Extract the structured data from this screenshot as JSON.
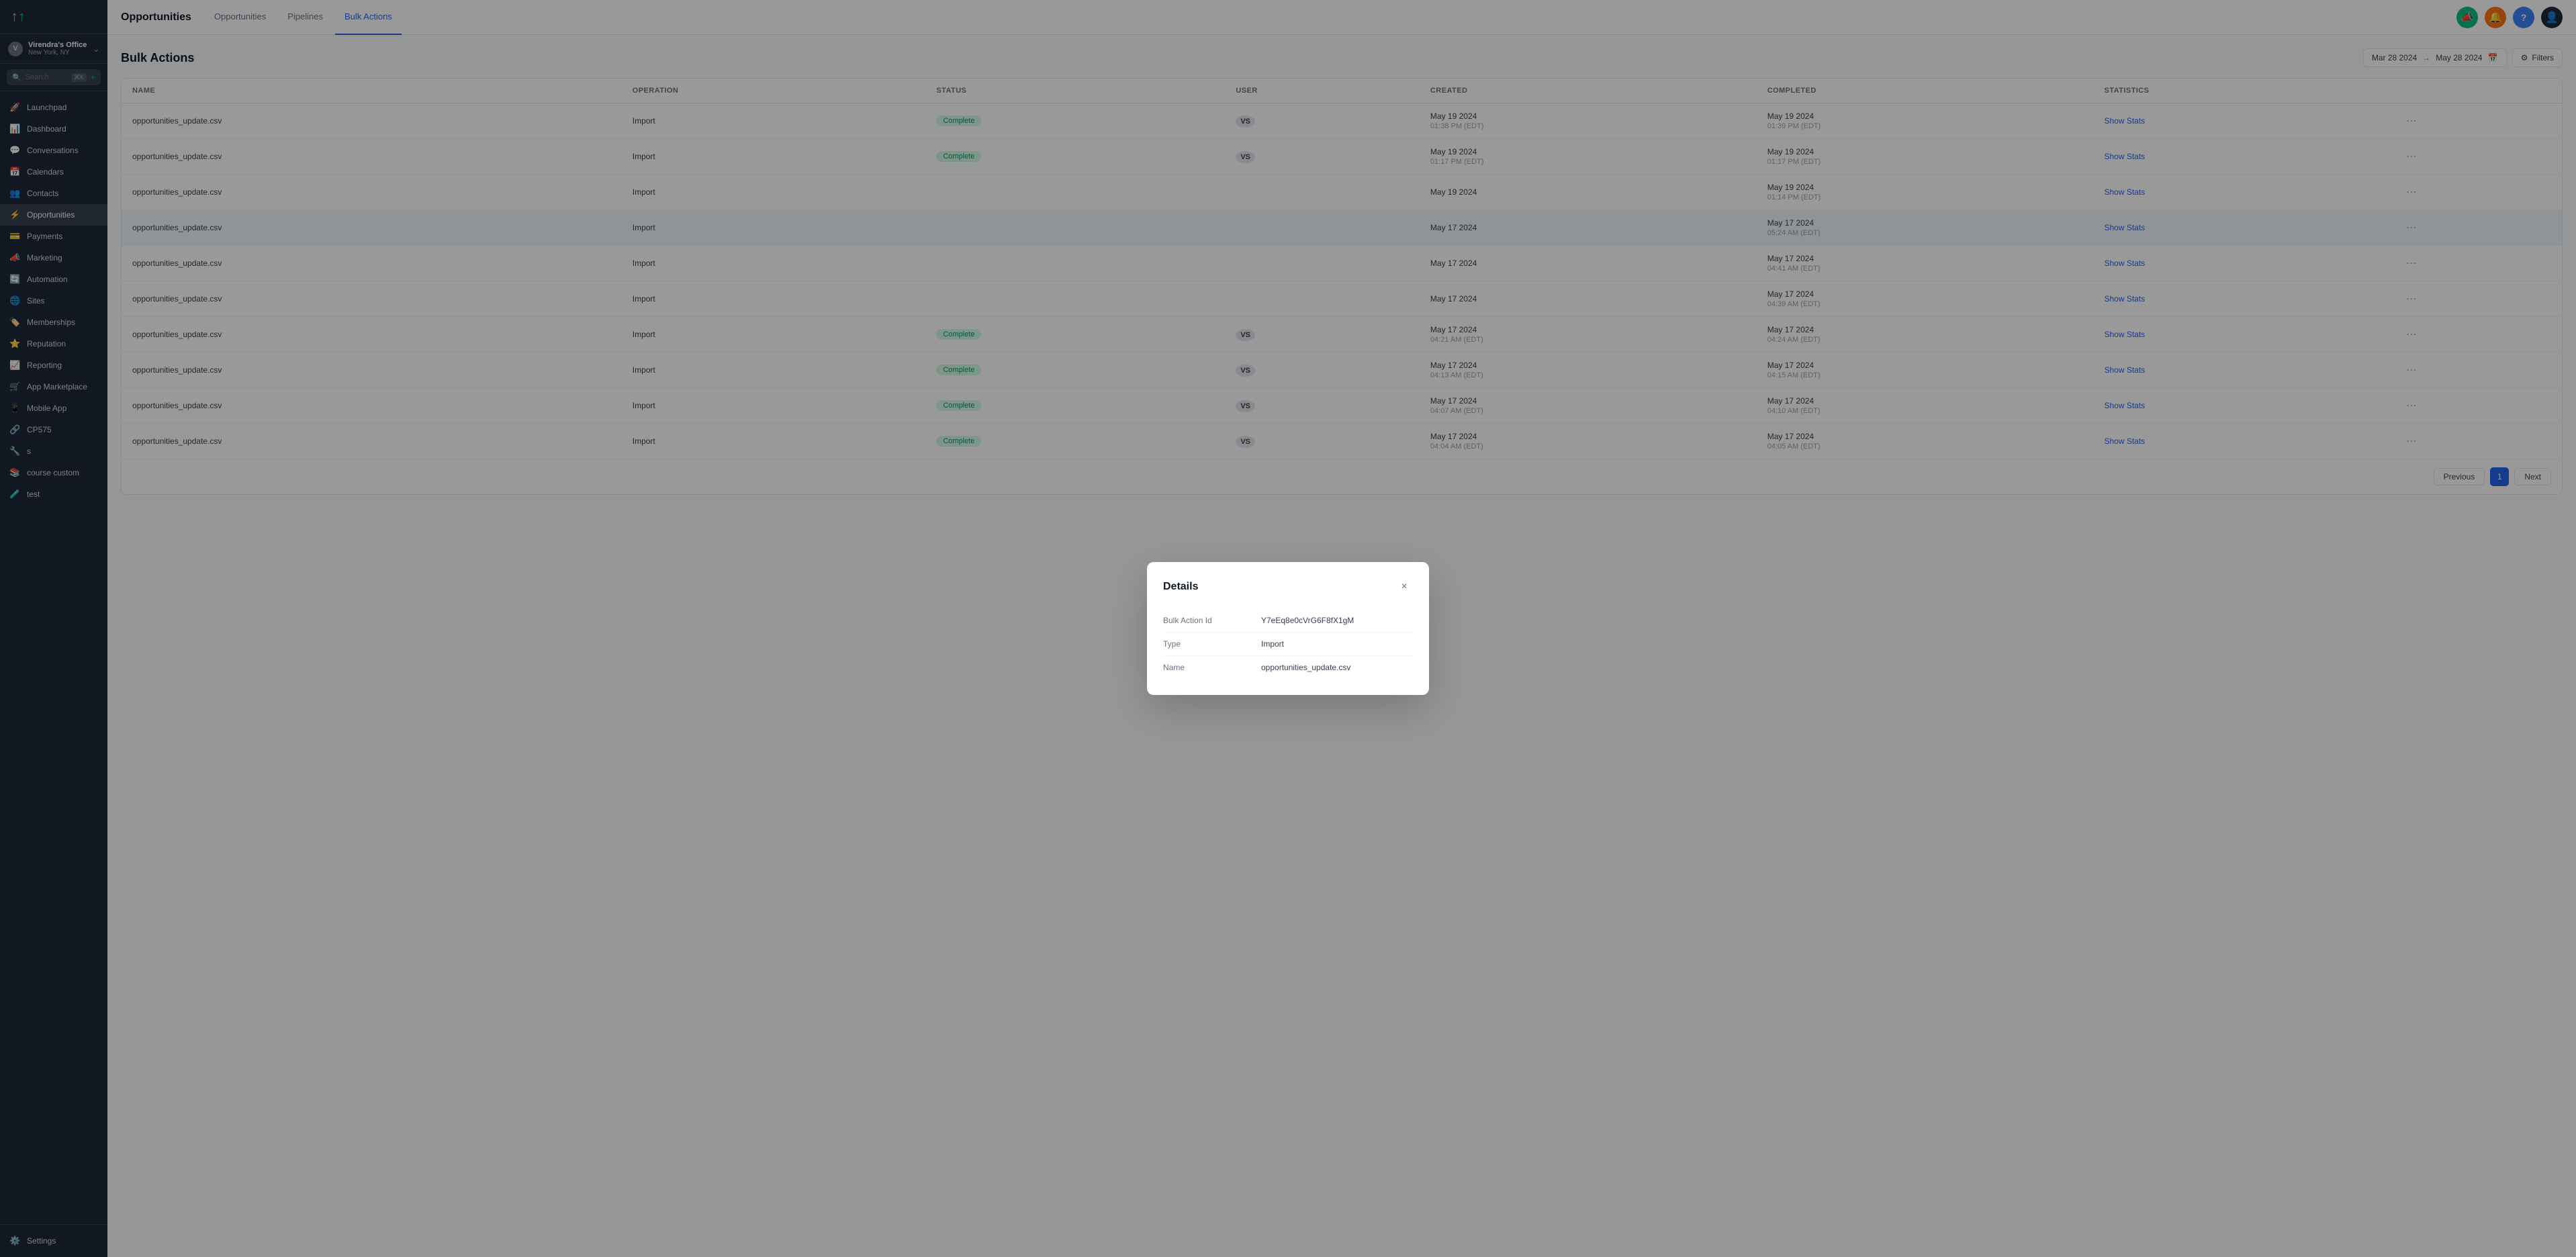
{
  "app": {
    "logo": "↑↑",
    "logo_colors": [
      "#f59e0b",
      "#10b981"
    ]
  },
  "workspace": {
    "name": "Virendra's Office",
    "location": "New York, NY",
    "initials": "V"
  },
  "search": {
    "placeholder": "Search",
    "shortcut": "⌘K"
  },
  "sidebar": {
    "nav_items": [
      {
        "id": "launchpad",
        "label": "Launchpad",
        "icon": "🚀"
      },
      {
        "id": "dashboard",
        "label": "Dashboard",
        "icon": "📊"
      },
      {
        "id": "conversations",
        "label": "Conversations",
        "icon": "💬"
      },
      {
        "id": "calendars",
        "label": "Calendars",
        "icon": "📅"
      },
      {
        "id": "contacts",
        "label": "Contacts",
        "icon": "👥"
      },
      {
        "id": "opportunities",
        "label": "Opportunities",
        "icon": "⚡",
        "active": true
      },
      {
        "id": "payments",
        "label": "Payments",
        "icon": "💳"
      },
      {
        "id": "marketing",
        "label": "Marketing",
        "icon": "📣"
      },
      {
        "id": "automation",
        "label": "Automation",
        "icon": "🔄"
      },
      {
        "id": "sites",
        "label": "Sites",
        "icon": "🌐"
      },
      {
        "id": "memberships",
        "label": "Memberships",
        "icon": "🏷️"
      },
      {
        "id": "reputation",
        "label": "Reputation",
        "icon": "⭐"
      },
      {
        "id": "reporting",
        "label": "Reporting",
        "icon": "📈"
      },
      {
        "id": "app-marketplace",
        "label": "App Marketplace",
        "icon": "🛒"
      },
      {
        "id": "mobile-app",
        "label": "Mobile App",
        "icon": "📱"
      },
      {
        "id": "cp575",
        "label": "CP575",
        "icon": "🔗"
      },
      {
        "id": "s",
        "label": "s",
        "icon": "🔧"
      },
      {
        "id": "course-custom",
        "label": "course custom",
        "icon": "📚"
      },
      {
        "id": "test",
        "label": "test",
        "icon": "🧪"
      }
    ],
    "bottom": [
      {
        "id": "settings",
        "label": "Settings",
        "icon": "⚙️"
      }
    ]
  },
  "topbar": {
    "icons": [
      {
        "id": "megaphone",
        "symbol": "📣",
        "color": "green"
      },
      {
        "id": "bell",
        "symbol": "🔔",
        "color": "orange"
      },
      {
        "id": "question",
        "symbol": "?",
        "color": "blue"
      },
      {
        "id": "user",
        "symbol": "👤",
        "color": "dark"
      }
    ]
  },
  "page": {
    "title": "Opportunities",
    "tabs": [
      {
        "id": "opportunities",
        "label": "Opportunities"
      },
      {
        "id": "pipelines",
        "label": "Pipelines"
      },
      {
        "id": "bulk-actions",
        "label": "Bulk Actions",
        "active": true
      }
    ]
  },
  "bulk_actions": {
    "title": "Bulk Actions",
    "date_from": "Mar 28 2024",
    "date_to": "May 28 2024",
    "filters_label": "Filters",
    "columns": [
      {
        "id": "name",
        "label": "Name"
      },
      {
        "id": "operation",
        "label": "Operation"
      },
      {
        "id": "status",
        "label": "Status"
      },
      {
        "id": "user",
        "label": "User"
      },
      {
        "id": "created",
        "label": "Created"
      },
      {
        "id": "completed",
        "label": "Completed"
      },
      {
        "id": "statistics",
        "label": "Statistics"
      }
    ],
    "rows": [
      {
        "id": "r1",
        "name": "opportunities_update.csv",
        "operation": "Import",
        "status": "Complete",
        "user": "VS",
        "created": "May 19 2024\n01:38 PM (EDT)",
        "completed": "May 19 2024\n01:39 PM (EDT)",
        "show_stats": "Show Stats"
      },
      {
        "id": "r2",
        "name": "opportunities_update.csv",
        "operation": "Import",
        "status": "Complete",
        "user": "VS",
        "created": "May 19 2024\n01:17 PM (EDT)",
        "completed": "May 19 2024\n01:17 PM (EDT)",
        "show_stats": "Show Stats"
      },
      {
        "id": "r3",
        "name": "opportunities_update.csv",
        "operation": "Import",
        "status": "",
        "user": "",
        "created": "May 19 2024",
        "completed": "May 19 2024\n01:14 PM (EDT)",
        "show_stats": "Show Stats"
      },
      {
        "id": "r4",
        "name": "opportunities_update.csv",
        "operation": "Import",
        "status": "",
        "user": "",
        "created": "May 17 2024",
        "completed": "May 17 2024\n05:24 AM (EDT)",
        "show_stats": "Show Stats",
        "highlighted": true
      },
      {
        "id": "r5",
        "name": "opportunities_update.csv",
        "operation": "Import",
        "status": "",
        "user": "",
        "created": "May 17 2024",
        "completed": "May 17 2024\n04:41 AM (EDT)",
        "show_stats": "Show Stats"
      },
      {
        "id": "r6",
        "name": "opportunities_update.csv",
        "operation": "Import",
        "status": "",
        "user": "",
        "created": "May 17 2024",
        "completed": "May 17 2024\n04:39 AM (EDT)",
        "show_stats": "Show Stats"
      },
      {
        "id": "r7",
        "name": "opportunities_update.csv",
        "operation": "Import",
        "status": "Complete",
        "user": "VS",
        "created": "May 17 2024\n04:21 AM (EDT)",
        "completed": "May 17 2024\n04:24 AM (EDT)",
        "show_stats": "Show Stats"
      },
      {
        "id": "r8",
        "name": "opportunities_update.csv",
        "operation": "Import",
        "status": "Complete",
        "user": "VS",
        "created": "May 17 2024\n04:13 AM (EDT)",
        "completed": "May 17 2024\n04:15 AM (EDT)",
        "show_stats": "Show Stats"
      },
      {
        "id": "r9",
        "name": "opportunities_update.csv",
        "operation": "Import",
        "status": "Complete",
        "user": "VS",
        "created": "May 17 2024\n04:07 AM (EDT)",
        "completed": "May 17 2024\n04:10 AM (EDT)",
        "show_stats": "Show Stats"
      },
      {
        "id": "r10",
        "name": "opportunities_update.csv",
        "operation": "Import",
        "status": "Complete",
        "user": "VS",
        "created": "May 17 2024\n04:04 AM (EDT)",
        "completed": "May 17 2024\n04:05 AM (EDT)",
        "show_stats": "Show Stats"
      }
    ],
    "pagination": {
      "previous": "Previous",
      "next": "Next",
      "current_page": "1"
    }
  },
  "modal": {
    "title": "Details",
    "fields": [
      {
        "id": "bulk-action-id",
        "label": "Bulk Action Id",
        "value": "Y7eEq8e0cVrG6F8fX1gM"
      },
      {
        "id": "type",
        "label": "Type",
        "value": "Import"
      },
      {
        "id": "name",
        "label": "Name",
        "value": "opportunities_update.csv"
      }
    ],
    "close_label": "×"
  }
}
